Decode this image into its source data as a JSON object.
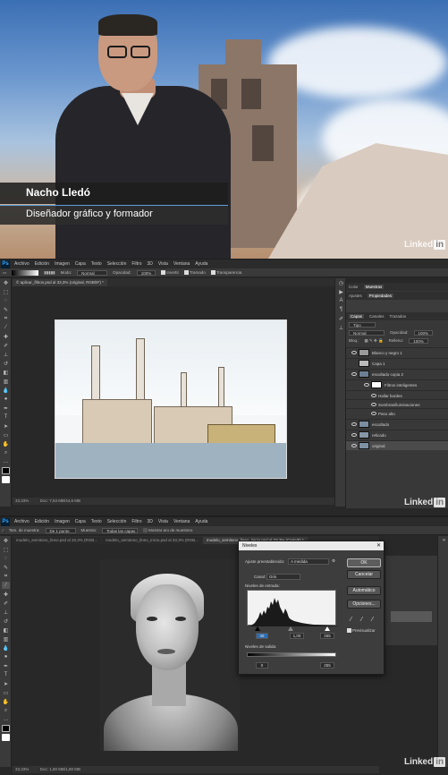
{
  "video": {
    "presenter_name": "Nacho Lledó",
    "presenter_role": "Diseñador gráfico y formador",
    "watermark": "Linked",
    "watermark_in": "in"
  },
  "photoshop_top": {
    "logo": "Ps",
    "menu": [
      "Archivo",
      "Edición",
      "Imagen",
      "Capa",
      "Texto",
      "Selección",
      "Filtro",
      "3D",
      "Vista",
      "Ventana",
      "Ayuda"
    ],
    "options": {
      "modo_label": "Modo:",
      "modo_value": "Normal",
      "opacidad_label": "Opacidad:",
      "opacidad_value": "100%",
      "invertir": "Invertir",
      "tramado": "Tramado",
      "transparencia": "Transparencia"
    },
    "document_tab": "© aplicar_filtros.psd al 33,3% (original, RGB/8*) *",
    "status_zoom": "33,33%",
    "status_doc": "Doc: 7,63 MB/44,6 MB",
    "panel_tabs": [
      "Color",
      "Muestras"
    ],
    "panel_tabs2": [
      "Ajustes",
      "Propiedades"
    ],
    "panel_tabs3": [
      "Capas",
      "Canales",
      "Trazados"
    ],
    "layer_filter": "Tipo",
    "blend_mode": "Normal",
    "opacity_label": "Opacidad:",
    "opacity_value": "100%",
    "lock_label": "Bloq.:",
    "fill_label": "Relleno:",
    "fill_value": "100%",
    "layers": [
      {
        "name": "Blanco y negro 1"
      },
      {
        "name": "Capa 1"
      },
      {
        "name": "escultado copia 2"
      },
      {
        "name": "Filtros inteligentes"
      },
      {
        "name": "Hallar bordes"
      },
      {
        "name": "Sombras/iluminaciones"
      },
      {
        "name": "Paso alto"
      },
      {
        "name": "escultado"
      },
      {
        "name": "relicado"
      },
      {
        "name": "original"
      }
    ],
    "watermark": "Linked",
    "watermark_in": "in"
  },
  "photoshop_bottom": {
    "logo": "Ps",
    "menu": [
      "Archivo",
      "Edición",
      "Imagen",
      "Capa",
      "Texto",
      "Selección",
      "Filtro",
      "3D",
      "Vista",
      "Ventana",
      "Ayuda"
    ],
    "options": {
      "muestra_label": "Tam. de muestra:",
      "muestra_value": "De 1 punto",
      "muestra2": "Muestra:",
      "muestra2_value": "Todas las capas",
      "anillo": "Mostrar aro de muestreo"
    },
    "tabs": [
      "modelo_semitono_lineo.psd al 33,3% (RGB...",
      "modelo_semitono_lineo_inicio.psd al 33,3% (RGB...",
      "modelo_semitono_lineo_inicio.psd al 33,3% (Cielo/8) *"
    ],
    "status_zoom": "33,33%",
    "status_doc": "Doc: 1,80 MB/1,80 MB",
    "levels_dialog": {
      "title": "Niveles",
      "preset_label": "Ajuste preestablecido:",
      "preset_value": "A medida",
      "channel_label": "Canal:",
      "channel_value": "Gris",
      "input_label": "Niveles de entrada:",
      "input_black": "38",
      "input_gamma": "1,00",
      "input_white": "255",
      "output_label": "Niveles de salida:",
      "output_black": "0",
      "output_white": "255",
      "ok": "OK",
      "cancel": "Cancelar",
      "auto": "Automático",
      "options": "Opciones...",
      "preview": "Previsualizar"
    },
    "watermark": "Linked",
    "watermark_in": "in"
  },
  "colors": {
    "ps_blue": "#31a8ff",
    "lower_third_accent": "#5b9bd5",
    "linkedin_bg": "#ffffff"
  }
}
